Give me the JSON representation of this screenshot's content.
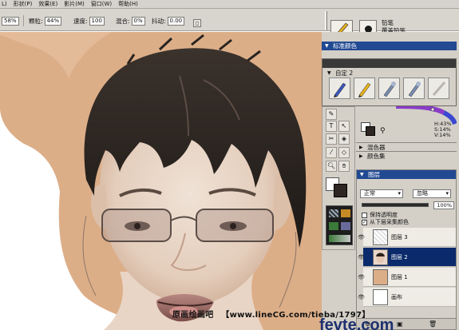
{
  "menu": {
    "items": [
      "L)",
      "形状(P)",
      "效果(E)",
      "影片(M)",
      "窗口(W)",
      "帮助(H)"
    ]
  },
  "options": {
    "opacity_value": "58%",
    "grain_label": "颗粒:",
    "grain_value": "44%",
    "speed_label": "速度:",
    "speed_value": "100",
    "blend_label": "混合:",
    "blend_value": "0%",
    "jitter_label": "抖动:",
    "jitter_value": "0.00",
    "brush_category": "铅笔",
    "brush_variant": "覆盖铅笔"
  },
  "panels": {
    "mixer_title": "标准颜色",
    "custom_title": "自定 2",
    "color_readout": {
      "h": "H:43%",
      "s": "S:14%",
      "v": "V:14%"
    },
    "mixer_pad": "混色器",
    "color_set": "颜色集"
  },
  "layers": {
    "title": "图层",
    "composite_method": "正常",
    "composite_depth": "忽略",
    "opacity": "100%",
    "preserve_transparency": "保持透明度",
    "pick_up_underlying": "从下层采集颜色",
    "items": [
      {
        "name": "图层 3",
        "visible": true,
        "selected": false
      },
      {
        "name": "图层 2",
        "visible": true,
        "selected": true
      },
      {
        "name": "图层 1",
        "visible": true,
        "selected": false
      },
      {
        "name": "画布",
        "visible": true,
        "selected": false
      }
    ]
  },
  "watermark": {
    "site_cn": "原画绘画吧",
    "text": "【www.lineCG.com/tieba/1797】",
    "brand": "fevte.com"
  },
  "colors": {
    "panel_bg": "#d4d0c8",
    "title_blue": "#224a92",
    "selected_layer": "#0a2a6b",
    "skin_bg": "#dcae88"
  }
}
